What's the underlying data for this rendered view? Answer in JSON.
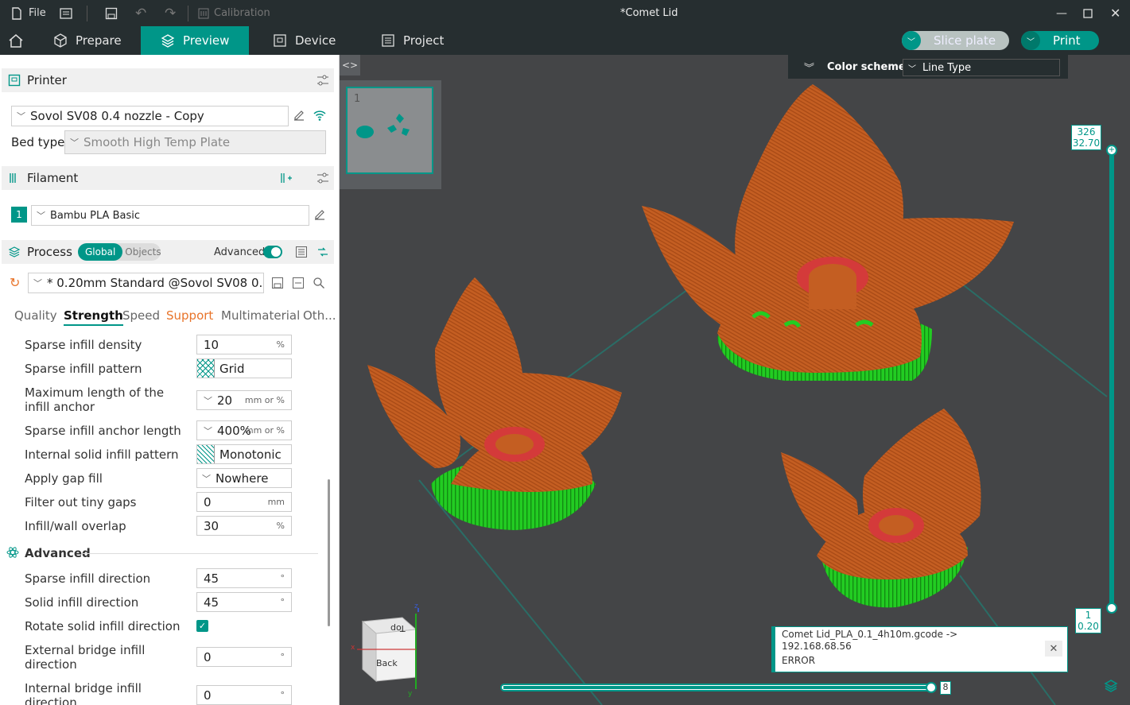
{
  "titlebar": {
    "file_label": "File",
    "calibration_label": "Calibration",
    "window_title": "*Comet Lid"
  },
  "tabs": {
    "prepare": "Prepare",
    "preview": "Preview",
    "device": "Device",
    "project": "Project",
    "slice_plate": "Slice plate",
    "print": "Print"
  },
  "printer": {
    "section_title": "Printer",
    "selected_printer": "Sovol SV08 0.4 nozzle - Copy",
    "bed_type_label": "Bed type",
    "bed_type_value": "Smooth High Temp Plate"
  },
  "filament": {
    "section_title": "Filament",
    "slot_number": "1",
    "selected": "Bambu PLA Basic"
  },
  "process": {
    "section_title": "Process",
    "toggle_global": "Global",
    "toggle_objects": "Objects",
    "advanced_label": "Advanced",
    "preset": "* 0.20mm Standard @Sovol SV08 0.4 ...",
    "tabs": [
      "Quality",
      "Strength",
      "Speed",
      "Support",
      "Multimaterial",
      "Oth..."
    ]
  },
  "params": [
    {
      "label": "Sparse infill density",
      "value": "10",
      "unit": "%"
    },
    {
      "label": "Sparse infill pattern",
      "value": "Grid",
      "unit": ""
    },
    {
      "label": "Maximum length of the infill anchor",
      "value": "20",
      "unit": "mm or %"
    },
    {
      "label": "Sparse infill anchor length",
      "value": "400%",
      "unit": "mm or %"
    },
    {
      "label": "Internal solid infill pattern",
      "value": "Monotonic",
      "unit": ""
    },
    {
      "label": "Apply gap fill",
      "value": "Nowhere",
      "unit": ""
    },
    {
      "label": "Filter out tiny gaps",
      "value": "0",
      "unit": "mm"
    },
    {
      "label": "Infill/wall overlap",
      "value": "30",
      "unit": "%"
    }
  ],
  "advanced_section": {
    "title": "Advanced",
    "params": [
      {
        "label": "Sparse infill direction",
        "value": "45",
        "unit": "°"
      },
      {
        "label": "Solid infill direction",
        "value": "45",
        "unit": "°"
      },
      {
        "label": "Rotate solid infill direction",
        "value": "",
        "unit": ""
      },
      {
        "label": "External bridge infill direction",
        "value": "0",
        "unit": "°"
      },
      {
        "label": "Internal bridge infill direction",
        "value": "0",
        "unit": "°"
      }
    ]
  },
  "viewport": {
    "color_scheme_label": "Color scheme",
    "color_scheme_value": "Line Type",
    "plate_number": "1",
    "layer_top_index": "326",
    "layer_top_height": "32.70",
    "layer_bottom_index": "1",
    "layer_bottom_height": "0.20",
    "move_slider_value": "8",
    "cube_top": "Top",
    "cube_back": "Back",
    "axis_z": "z",
    "axis_x": "x",
    "axis_y": "y",
    "notification_line1": "Comet Lid_PLA_0.1_4h10m.gcode ->",
    "notification_line2": "192.168.68.56",
    "notification_error": "ERROR"
  },
  "colors": {
    "accent": "#009688",
    "titlebar_bg": "#262e30",
    "viewport_bg": "#444547",
    "wall_orange": "#c45e22",
    "support_green": "#22cc22",
    "support_orange": "#e07a3a"
  }
}
